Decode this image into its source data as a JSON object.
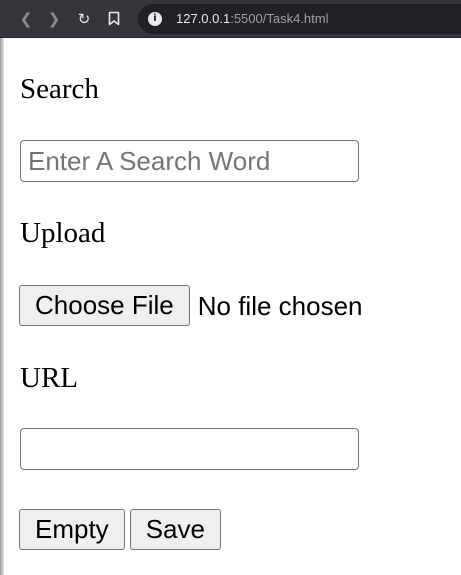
{
  "browser": {
    "url_host": "127.0.0.1",
    "url_rest": ":5500/Task4.html"
  },
  "icons": {
    "back": "back-arrow-icon",
    "forward": "forward-arrow-icon",
    "reload": "reload-icon",
    "bookmark": "bookmark-icon",
    "site_info": "info-icon"
  },
  "form": {
    "search": {
      "label": "Search",
      "placeholder": "Enter A Search Word",
      "value": ""
    },
    "upload": {
      "label": "Upload",
      "button_label": "Choose File",
      "status": "No file chosen"
    },
    "url": {
      "label": "URL",
      "value": ""
    },
    "actions": {
      "empty_label": "Empty",
      "save_label": "Save"
    }
  }
}
